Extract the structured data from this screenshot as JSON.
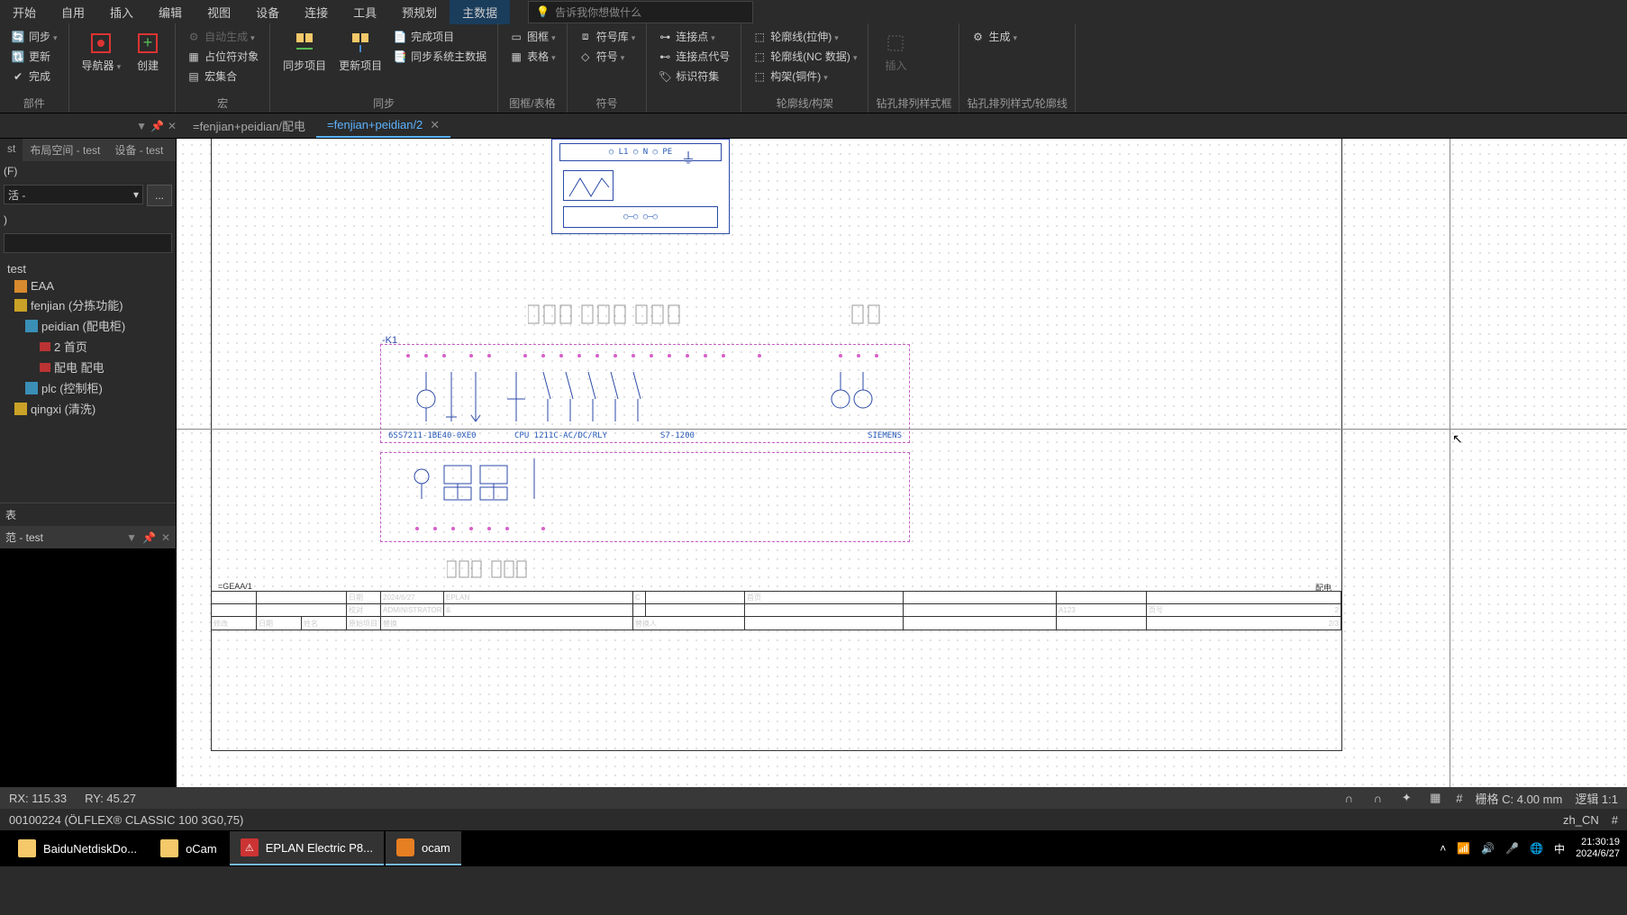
{
  "menu": [
    "开始",
    "自用",
    "插入",
    "编辑",
    "视图",
    "设备",
    "连接",
    "工具",
    "预规划",
    "主数据"
  ],
  "menu_active_index": 9,
  "search_placeholder": "告诉我你想做什么",
  "ribbon": {
    "g0": {
      "label": "部件",
      "sync": "同步",
      "update": "更新",
      "complete": "完成"
    },
    "g1": {
      "label": "",
      "nav": "导航器",
      "create": "创建"
    },
    "g2": {
      "label": "宏",
      "auto": "自动生成",
      "placeholder": "占位符对象",
      "macro": "宏集合"
    },
    "g3": {
      "label": "同步",
      "syncproj": "同步项目",
      "updateproj": "更新项目",
      "complproj": "完成项目",
      "syncsys": "同步系统主数据"
    },
    "g4": {
      "label": "图框/表格",
      "frame": "图框",
      "table": "表格"
    },
    "g5": {
      "label": "符号",
      "lib": "符号库",
      "sym": "符号"
    },
    "g6": {
      "label": "",
      "conn": "连接点",
      "connid": "连接点代号",
      "idset": "标识符集"
    },
    "g7": {
      "label": "轮廓线/构架",
      "c1": "轮廓线(拉伸)",
      "c2": "轮廓线(NC 数据)",
      "c3": "构架(铜件)"
    },
    "g8": {
      "label": "钻孔排列样式框",
      "ins": "插入"
    },
    "g9": {
      "label": "钻孔排列样式/轮廓线",
      "gen": "生成"
    }
  },
  "doc_tabs": [
    {
      "name": "=fenjian+peidian/配电",
      "active": false
    },
    {
      "name": "=fenjian+peidian/2",
      "active": true
    }
  ],
  "left": {
    "tab_st": "st",
    "tab_1": "布局空间 - test",
    "tab_2": "设备 - test",
    "filter_header": "(F)",
    "filter_val": "活 -",
    "filter_btn": "...",
    "search_hdr": ")",
    "tree": [
      {
        "label": "test",
        "indent": 0,
        "icon": "folder"
      },
      {
        "label": "EAA",
        "indent": 1,
        "icon": "orange"
      },
      {
        "label": "fenjian (分拣功能)",
        "indent": 1,
        "icon": "yellow"
      },
      {
        "label": "peidian (配电柜)",
        "indent": 2,
        "icon": "cyan"
      },
      {
        "label": "2 首页",
        "indent": 3,
        "icon": "red"
      },
      {
        "label": "配电 配电",
        "indent": 3,
        "icon": "red"
      },
      {
        "label": "plc (控制柜)",
        "indent": 2,
        "icon": "cyan"
      },
      {
        "label": "qingxi (清洗)",
        "indent": 1,
        "icon": "yellow"
      }
    ],
    "section1": "表",
    "section2": "范 - test"
  },
  "schematic": {
    "k_label": "-K1",
    "part_no": "6SS7211-1BE40-0XE0",
    "cpu": "CPU 1211C-AC/DC/RLY",
    "series": "S7-1200",
    "vendor": "SIEMENS",
    "tag_tl": "=GEAA/1",
    "tag_tr": "配电",
    "tb": {
      "date_l": "日期",
      "date_v": "2024/6/27",
      "user_l": "校对",
      "user_v": "ADMINISTRATOR",
      "eplan": "EPLAN",
      "page": "首页",
      "a123": "A123",
      "pg": "页号",
      "pg_v": "2",
      "of": "2/3"
    }
  },
  "status": {
    "rx": "RX: 115.33",
    "ry": "RY: 45.27",
    "grid": "栅格 C: 4.00 mm",
    "zoom": "逻辑 1:1",
    "cable": "00100224 (ÖLFLEX® CLASSIC 100 3G0,75)",
    "locale": "zh_CN",
    "hash": "#"
  },
  "taskbar": {
    "items": [
      {
        "label": "BaiduNetdiskDo...",
        "icon": "folder"
      },
      {
        "label": "oCam",
        "icon": "folder"
      },
      {
        "label": "EPLAN Electric P8...",
        "icon": "eplan",
        "active": true
      },
      {
        "label": "ocam",
        "icon": "ocam",
        "active": true
      }
    ],
    "ime": "中",
    "time": "21:30:19",
    "date": "2024/6/27"
  }
}
